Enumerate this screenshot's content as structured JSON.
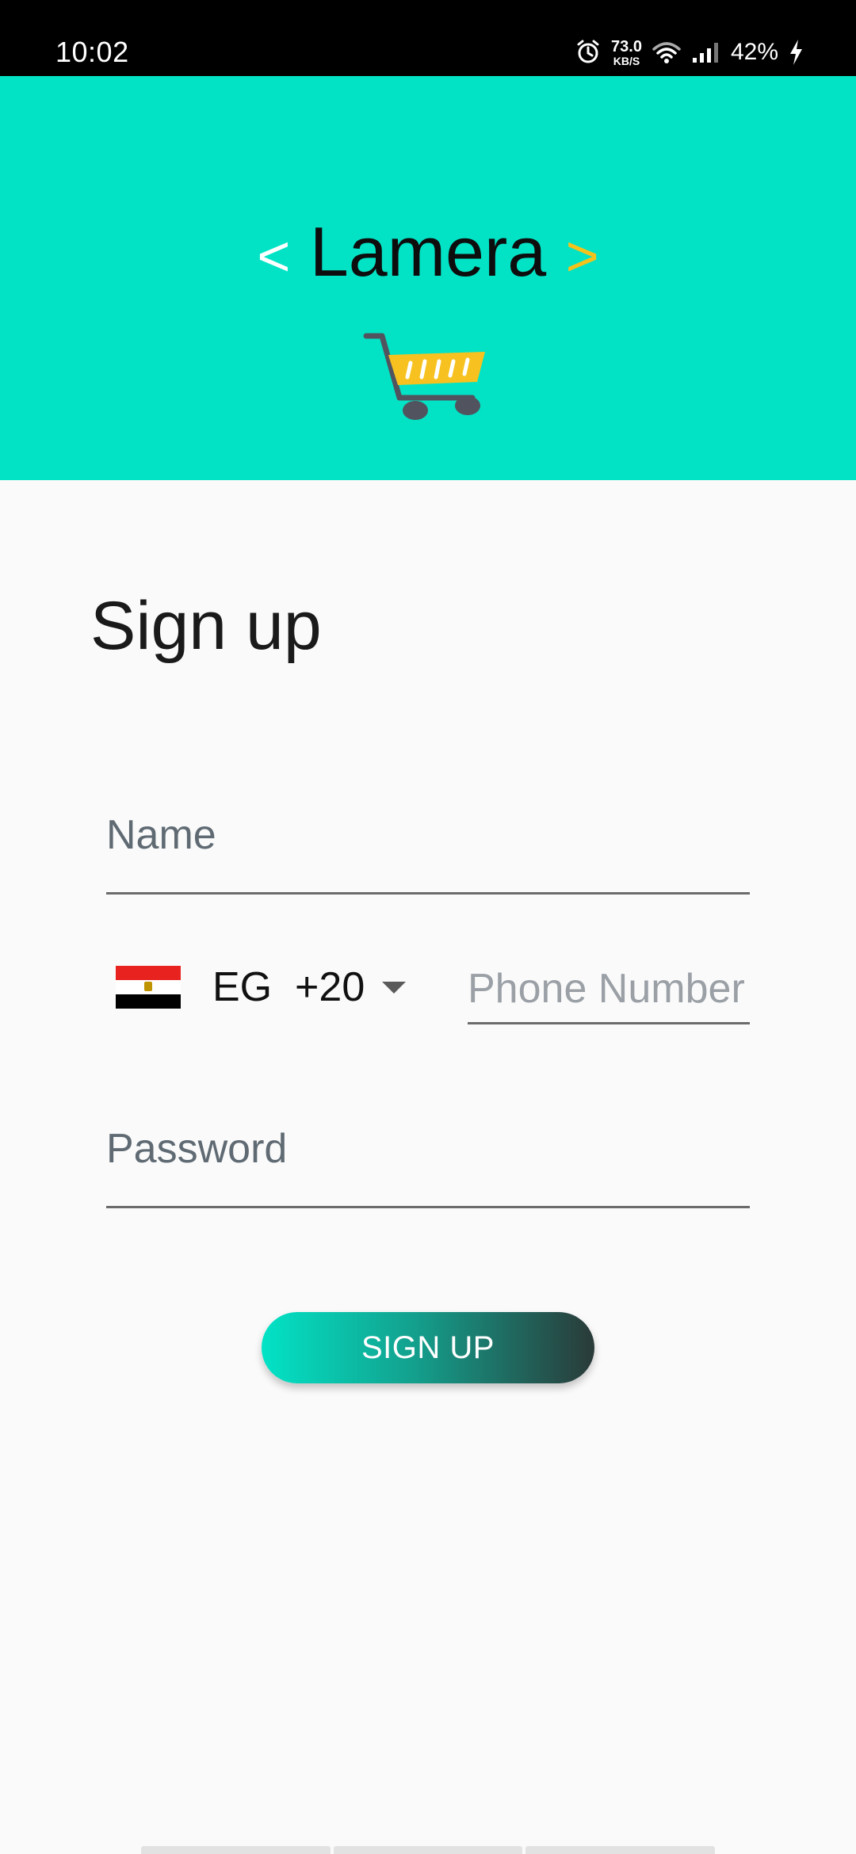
{
  "status_bar": {
    "time": "10:02",
    "speed_value": "73.0",
    "speed_unit": "KB/S",
    "battery": "42%",
    "icons": [
      "alarm-icon",
      "wifi-icon",
      "signal-icon",
      "charging-icon"
    ]
  },
  "header": {
    "open_bracket": "<",
    "app_name": "Lamera",
    "close_bracket": ">",
    "logo_icon": "shopping-cart-icon",
    "colors": {
      "background": "#02e3c6",
      "open_bracket": "#ffffff",
      "close_bracket": "#f5c21b"
    }
  },
  "form": {
    "title": "Sign up",
    "name_placeholder": "Name",
    "country": {
      "flag": "egypt-flag",
      "code": "EG",
      "dial_code": "+20"
    },
    "phone_placeholder": "Phone Number",
    "password_placeholder": "Password",
    "submit_label": "SIGN UP"
  }
}
